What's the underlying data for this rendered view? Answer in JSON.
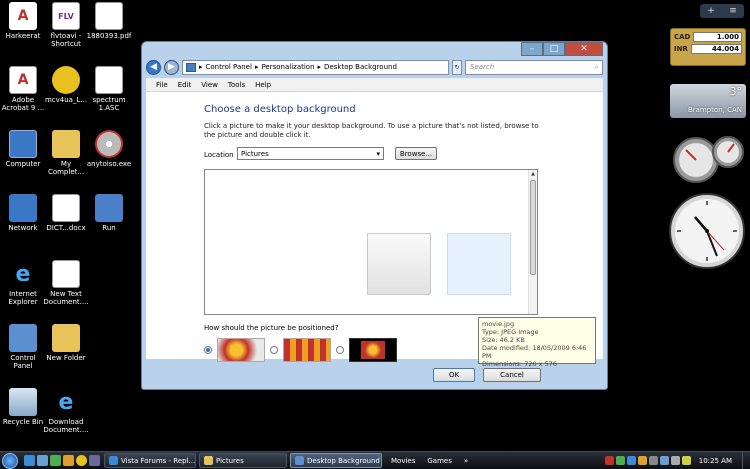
{
  "desktop": {
    "icons": [
      {
        "label": "Harkeerat",
        "glyph": "A"
      },
      {
        "label": "flvtoavi - Shortcut",
        "glyph": "FLV"
      },
      {
        "label": "1880393.pdf",
        "glyph": ""
      },
      {
        "label": "Adobe Acrobat 9 ...",
        "glyph": ""
      },
      {
        "label": "mcv4ua_L...",
        "glyph": ""
      },
      {
        "label": "spectrum 1.ASC",
        "glyph": ""
      },
      {
        "label": "Computer",
        "glyph": ""
      },
      {
        "label": "My Complet...",
        "glyph": ""
      },
      {
        "label": "anytoiso.exe",
        "glyph": ""
      },
      {
        "label": "Network",
        "glyph": ""
      },
      {
        "label": "DICT...docx",
        "glyph": ""
      },
      {
        "label": "Run",
        "glyph": ""
      },
      {
        "label": "Internet Explorer",
        "glyph": "e"
      },
      {
        "label": "New Text Document....",
        "glyph": ""
      },
      {
        "label": "Control Panel",
        "glyph": ""
      },
      {
        "label": "New Folder",
        "glyph": ""
      },
      {
        "label": "Recycle Bin",
        "glyph": ""
      },
      {
        "label": "Download Document....",
        "glyph": "e"
      }
    ]
  },
  "gadgets": {
    "toolbar": {
      "add": "+",
      "menu": "≡"
    },
    "currency": {
      "code1": "CAD",
      "value1": "1.000",
      "code2": "INR",
      "value2": "44.004"
    },
    "weather": {
      "temp": "3°",
      "city": "Brampton, CAN"
    }
  },
  "window": {
    "controls": {
      "min": "–",
      "max": "□",
      "close": "✕"
    },
    "nav": {
      "back": "◀",
      "forward": "▶"
    },
    "address": {
      "crumbs": [
        "Control Panel",
        "Personalization",
        "Desktop Background"
      ],
      "sep": "▸"
    },
    "refresh": "↻",
    "search": {
      "placeholder": "Search",
      "icon": "⌕"
    },
    "menu": [
      "File",
      "Edit",
      "View",
      "Tools",
      "Help"
    ],
    "heading": "Choose a desktop background",
    "description": "Click a picture to make it your desktop background. To use a picture that's not listed, browse to the picture and double click it.",
    "location": {
      "label": "Location",
      "value": "Pictures",
      "browse": "Browse..."
    },
    "tooltip": {
      "lines": [
        "movie.jpg",
        "Type: JPEG Image",
        "Size: 46.2 KB",
        "Date modified: 18/05/2009 6:46 PM",
        "Dimensions: 720 x 576"
      ]
    },
    "position_question": "How should the picture be positioned?",
    "buttons": {
      "ok": "OK",
      "cancel": "Cancel"
    }
  },
  "taskbar": {
    "items": [
      {
        "label": "Vista Forums - Repl...",
        "active": false
      },
      {
        "label": "Pictures",
        "active": false
      },
      {
        "label": "Desktop Background",
        "active": true
      }
    ],
    "toolbars": [
      "Movies",
      "Games"
    ],
    "expand": "»",
    "time": "10:25 AM"
  },
  "colors": {
    "accent": "#1e3a8a",
    "selection": "#2b6dc2"
  }
}
